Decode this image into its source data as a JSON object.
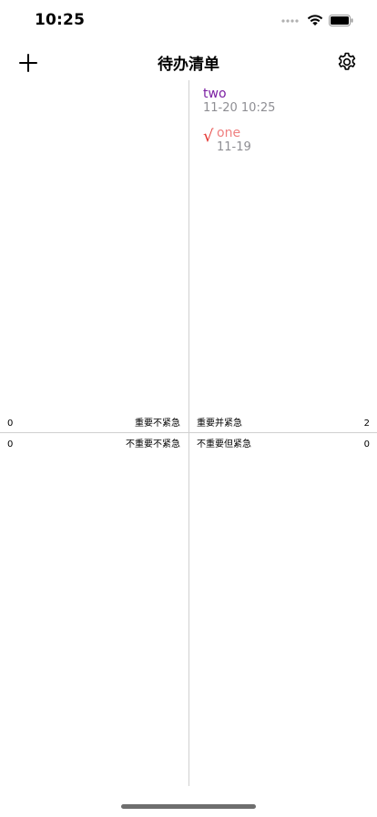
{
  "status": {
    "time": "10:25"
  },
  "nav": {
    "title": "待办清单",
    "add_icon": "plus-icon",
    "settings_icon": "gear-icon"
  },
  "quadrants": {
    "top_left": {
      "count": "0",
      "label": "重要不紧急"
    },
    "top_right": {
      "label": "重要并紧急",
      "count": "2"
    },
    "bottom_left": {
      "count": "0",
      "label": "不重要不紧急"
    },
    "bottom_right": {
      "label": "不重要但紧急",
      "count": "0"
    }
  },
  "tasks": [
    {
      "title": "two",
      "date": "11-20 10:25",
      "done": false,
      "color": "#7b1fa2"
    },
    {
      "title": "one",
      "date": "11-19",
      "done": true,
      "check": "√",
      "color": "#ef8080"
    }
  ],
  "colors": {
    "check": "#e53935",
    "date": "#8e8e93",
    "divider": "#d0d0d0"
  }
}
